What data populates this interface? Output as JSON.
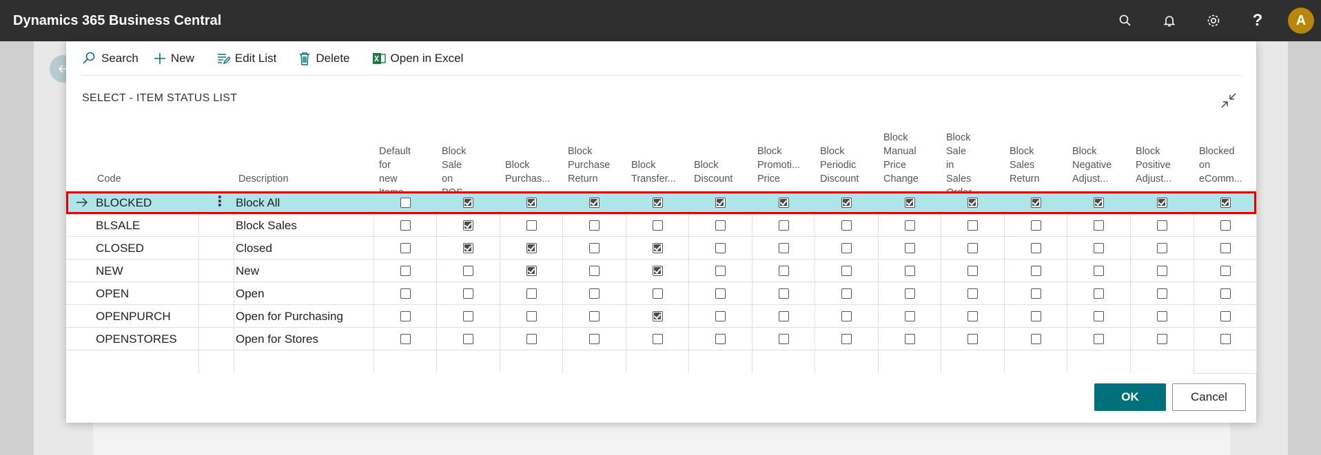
{
  "app": {
    "title": "Dynamics 365 Business Central",
    "avatar_letter": "A"
  },
  "topbar_icons": [
    "search-icon",
    "bell-icon",
    "gear-icon",
    "help-icon"
  ],
  "actions": [
    {
      "name": "search-action",
      "icon": "search-icon",
      "label": "Search"
    },
    {
      "name": "new-action",
      "icon": "plus-icon",
      "label": "New"
    },
    {
      "name": "edit-list-action",
      "icon": "edit-list-icon",
      "label": "Edit List"
    },
    {
      "name": "delete-action",
      "icon": "trash-icon",
      "label": "Delete"
    },
    {
      "name": "open-in-excel-action",
      "icon": "excel-icon",
      "label": "Open in Excel"
    }
  ],
  "dialog": {
    "title": "SELECT - ITEM STATUS LIST",
    "ok_label": "OK",
    "cancel_label": "Cancel"
  },
  "columns": {
    "code": "Code",
    "description": "Description",
    "flags": [
      [
        "Default",
        "for new",
        "Items"
      ],
      [
        "Block",
        "Sale on",
        "POS"
      ],
      [
        "Block",
        "Purchas..."
      ],
      [
        "Block",
        "Purchase",
        "Return"
      ],
      [
        "Block",
        "Transfer..."
      ],
      [
        "Block",
        "Discount"
      ],
      [
        "Block",
        "Promoti...",
        "Price"
      ],
      [
        "Block",
        "Periodic",
        "Discount"
      ],
      [
        "Block",
        "Manual",
        "Price",
        "Change"
      ],
      [
        "Block",
        "Sale in",
        "Sales",
        "Order"
      ],
      [
        "Block",
        "Sales",
        "Return"
      ],
      [
        "Block",
        "Negative",
        "Adjust..."
      ],
      [
        "Block",
        "Positive",
        "Adjust..."
      ],
      [
        "Blocked",
        "on",
        "eComm..."
      ]
    ]
  },
  "rows": [
    {
      "code": "BLOCKED",
      "description": "Block All",
      "selected": true,
      "flags": [
        0,
        1,
        1,
        1,
        1,
        1,
        1,
        1,
        1,
        1,
        1,
        1,
        1,
        1
      ]
    },
    {
      "code": "BLSALE",
      "description": "Block Sales",
      "selected": false,
      "flags": [
        0,
        1,
        0,
        0,
        0,
        0,
        0,
        0,
        0,
        0,
        0,
        0,
        0,
        0
      ]
    },
    {
      "code": "CLOSED",
      "description": "Closed",
      "selected": false,
      "flags": [
        0,
        1,
        1,
        0,
        1,
        0,
        0,
        0,
        0,
        0,
        0,
        0,
        0,
        0
      ]
    },
    {
      "code": "NEW",
      "description": "New",
      "selected": false,
      "flags": [
        0,
        0,
        1,
        0,
        1,
        0,
        0,
        0,
        0,
        0,
        0,
        0,
        0,
        0
      ]
    },
    {
      "code": "OPEN",
      "description": "Open",
      "selected": false,
      "flags": [
        0,
        0,
        0,
        0,
        0,
        0,
        0,
        0,
        0,
        0,
        0,
        0,
        0,
        0
      ]
    },
    {
      "code": "OPENPURCH",
      "description": "Open for Purchasing",
      "selected": false,
      "flags": [
        0,
        0,
        0,
        0,
        1,
        0,
        0,
        0,
        0,
        0,
        0,
        0,
        0,
        0
      ]
    },
    {
      "code": "OPENSTORES",
      "description": "Open for Stores",
      "selected": false,
      "flags": [
        0,
        0,
        0,
        0,
        0,
        0,
        0,
        0,
        0,
        0,
        0,
        0,
        0,
        0
      ]
    }
  ],
  "colors": {
    "topbar": "#2f2f2f",
    "accent": "#00707a",
    "selected_row": "#aee5e9",
    "selection_outline": "#e00000",
    "avatar": "#b8860b"
  }
}
